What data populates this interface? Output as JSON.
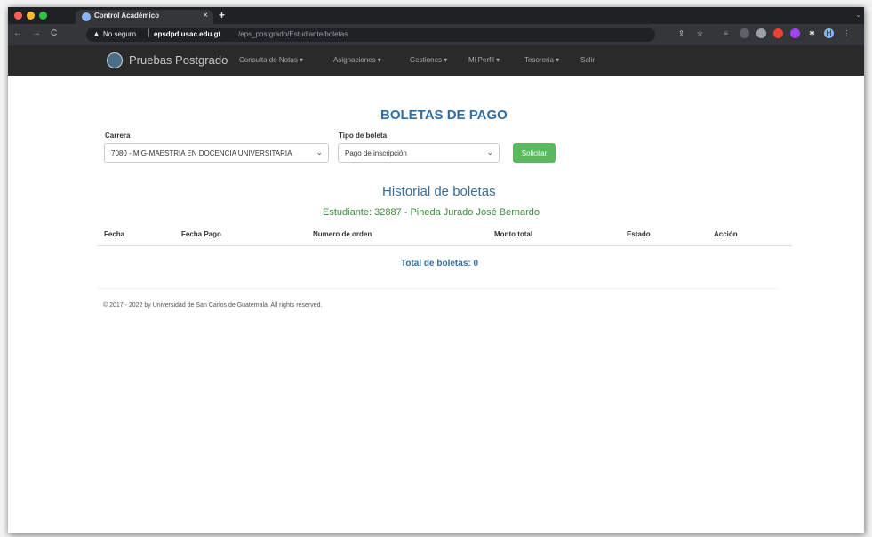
{
  "browser": {
    "tab_title": "Control Académico",
    "tab_close": "×",
    "new_tab": "+",
    "tab_search": "⌄",
    "back": "←",
    "forward": "→",
    "reload": "C",
    "security_label": "No seguro",
    "url_host": "epsdpd.usac.edu.gt",
    "url_path": "/eps_postgrado/Estudiante/boletas",
    "profile_initial": "H",
    "colors": {
      "tabstrip": "#202124",
      "toolbar": "#35363a",
      "close_dot": "#ff5f57",
      "min_dot": "#febc2e",
      "max_dot": "#28c840"
    }
  },
  "navbar": {
    "brand": "Pruebas Postgrado",
    "items": [
      {
        "label": "Consulta de Notas ▾"
      },
      {
        "label": "Asignaciones ▾"
      },
      {
        "label": "Gestiones ▾"
      },
      {
        "label": "Mi Perfil ▾"
      },
      {
        "label": "Tesoreria ▾"
      },
      {
        "label": "Salir"
      }
    ]
  },
  "form": {
    "title": "BOLETAS DE PAGO",
    "carrera_label": "Carrera",
    "carrera_value": "7080 - MIG-MAESTRIA EN DOCENCIA UNIVERSITARIA",
    "tipo_label": "Tipo de boleta",
    "tipo_value": "Pago de inscripción",
    "submit_label": "Solicitar",
    "colors": {
      "title": "#336e9e",
      "button": "#5cb85c"
    }
  },
  "history": {
    "title": "Historial de boletas",
    "student": "Estudiante: 32887 - Pineda Jurado José Bernardo",
    "columns": [
      "Fecha",
      "Fecha Pago",
      "Numero de orden",
      "Monto total",
      "Estado",
      "Acción"
    ],
    "rows": [],
    "total": "Total de boletas: 0",
    "colors": {
      "student": "#3c8a3c"
    }
  },
  "footer": {
    "text": "© 2017 - 2022 by Universidad de San Carlos de Guatemala. All rights reserved."
  }
}
